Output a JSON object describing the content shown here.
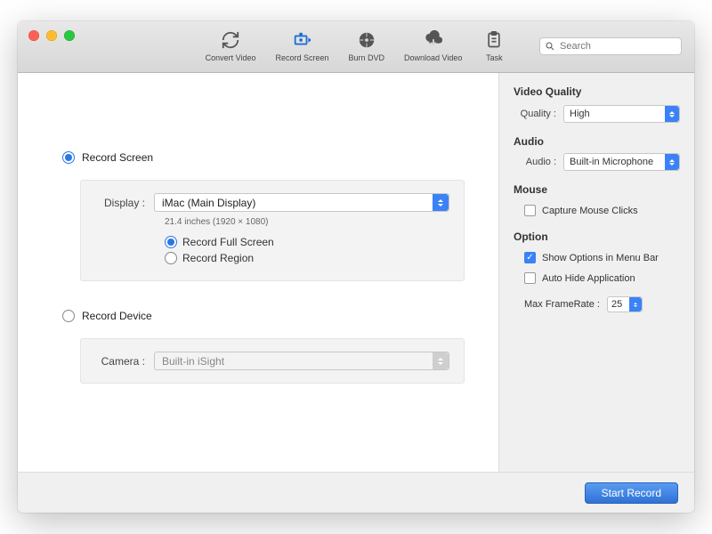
{
  "toolbar": {
    "items": [
      {
        "label": "Convert Video",
        "icon": "convert-icon"
      },
      {
        "label": "Record Screen",
        "icon": "record-icon"
      },
      {
        "label": "Burn DVD",
        "icon": "burn-icon"
      },
      {
        "label": "Download Video",
        "icon": "download-icon"
      },
      {
        "label": "Task",
        "icon": "task-icon"
      }
    ],
    "active_index": 1,
    "search_placeholder": "Search"
  },
  "main": {
    "record_screen": {
      "label": "Record Screen",
      "checked": true,
      "display_label": "Display :",
      "display_value": "iMac (Main Display)",
      "display_sub": "21.4 inches (1920 × 1080)",
      "full_screen": {
        "label": "Record Full Screen",
        "checked": true
      },
      "region": {
        "label": "Record Region",
        "checked": false
      }
    },
    "record_device": {
      "label": "Record Device",
      "checked": false,
      "camera_label": "Camera :",
      "camera_value": "Built-in iSight"
    }
  },
  "side": {
    "video_quality": {
      "title": "Video Quality",
      "label": "Quality :",
      "value": "High"
    },
    "audio": {
      "title": "Audio",
      "label": "Audio :",
      "value": "Built-in Microphone"
    },
    "mouse": {
      "title": "Mouse",
      "capture_clicks": {
        "label": "Capture Mouse Clicks",
        "checked": false
      }
    },
    "option": {
      "title": "Option",
      "show_menubar": {
        "label": "Show Options in Menu Bar",
        "checked": true
      },
      "auto_hide": {
        "label": "Auto Hide Application",
        "checked": false
      },
      "framerate_label": "Max FrameRate :",
      "framerate_value": "25"
    }
  },
  "footer": {
    "start_label": "Start Record"
  }
}
